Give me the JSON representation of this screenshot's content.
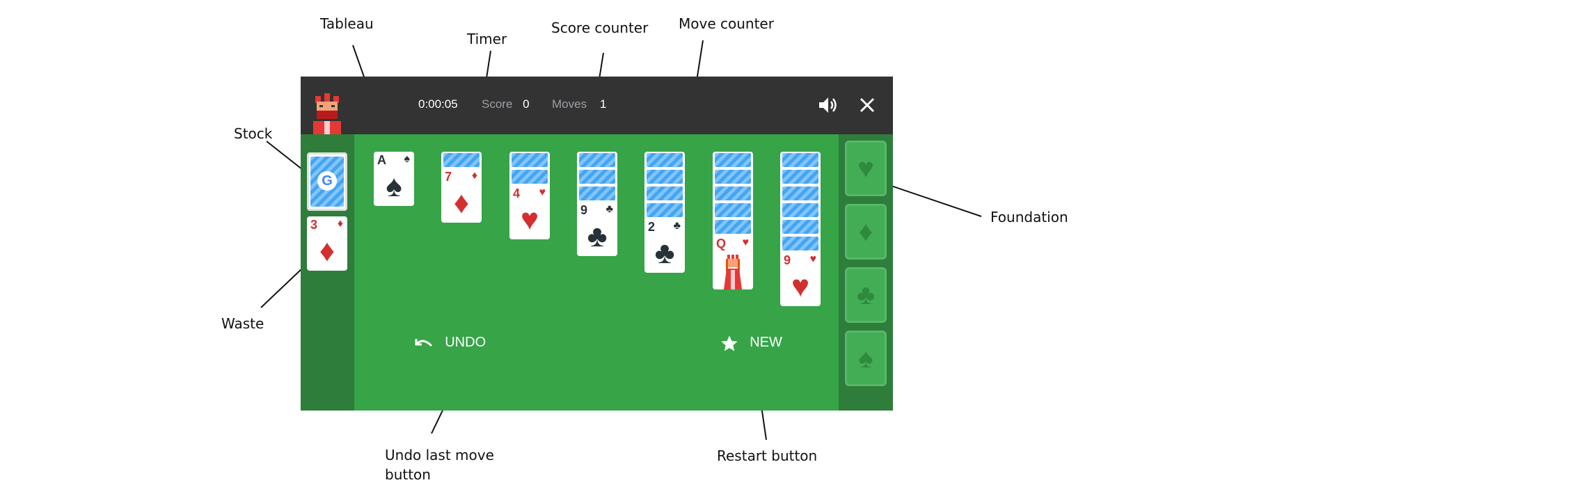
{
  "annotations": {
    "tableau": "Tableau",
    "timer": "Timer",
    "score_counter": "Score counter",
    "move_counter": "Move counter",
    "stock": "Stock",
    "waste": "Waste",
    "foundation": "Foundation",
    "undo_button": "Undo last move button",
    "restart_button": "Restart button"
  },
  "hud": {
    "timer": "0:00:05",
    "score_label": "Score",
    "score_value": "0",
    "moves_label": "Moves",
    "moves_value": "1"
  },
  "icons": {
    "avatar": "king-avatar-icon",
    "sound": "speaker-icon",
    "close": "close-icon",
    "undo": "undo-arrow-icon",
    "new": "star-icon",
    "stock_logo": "google-g-icon"
  },
  "waste": {
    "rank": "3",
    "suit_symbol": "♦"
  },
  "stock": {
    "logo_letter": "G"
  },
  "tableau": [
    {
      "rank": "A",
      "suit_symbol": "♠"
    },
    {
      "rank": "7",
      "suit_symbol": "♦"
    },
    {
      "rank": "4",
      "suit_symbol": "♥"
    },
    {
      "rank": "9",
      "suit_symbol": "♣"
    },
    {
      "rank": "2",
      "suit_symbol": "♣"
    },
    {
      "rank": "Q",
      "suit_symbol": "♥"
    },
    {
      "rank": "9",
      "suit_symbol": "♥"
    }
  ],
  "foundation": [
    "♥",
    "♦",
    "♣",
    "♠"
  ],
  "buttons": {
    "undo": "UNDO",
    "new": "NEW"
  },
  "colors": {
    "table": "#36a447",
    "rail": "#2e7d3b",
    "topbar": "#333333",
    "card_back": "#42a5f5",
    "red_suit": "#d32f2f",
    "black_suit": "#263238"
  }
}
